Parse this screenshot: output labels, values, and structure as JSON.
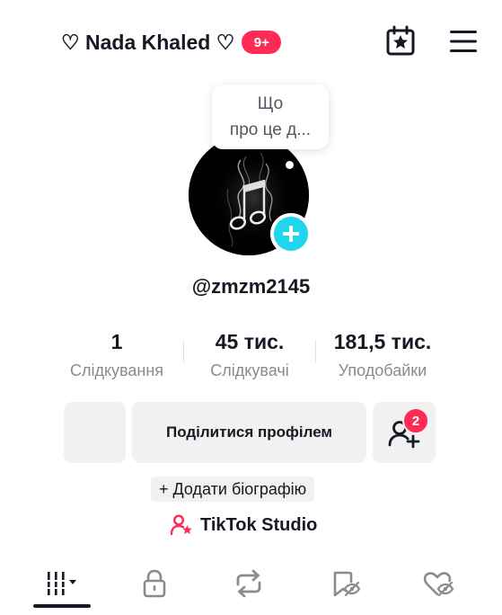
{
  "header": {
    "title": "♡ Nada Khaled ♡",
    "notification_badge": "9+",
    "calendar_icon": "calendar-star-icon",
    "menu_icon": "hamburger-menu-icon"
  },
  "profile": {
    "status_bubble": "Що\nпро це д...",
    "avatar_icon": "music-notes-avatar",
    "username": "@zmzm2145"
  },
  "stats": [
    {
      "value": "1",
      "label": "Слідкування"
    },
    {
      "value": "45 тис.",
      "label": "Слідкувачі"
    },
    {
      "value": "181,5 тис.",
      "label": "Уподобайки"
    }
  ],
  "actions": {
    "share_profile": "Поділитися профілем",
    "add_friends_badge": "2"
  },
  "bio_button": "+ Додати біографію",
  "studio_link": "TikTok Studio",
  "tabs": [
    {
      "icon": "videos-grid-icon"
    },
    {
      "icon": "lock-icon"
    },
    {
      "icon": "repost-icon"
    },
    {
      "icon": "favorites-hidden-icon"
    },
    {
      "icon": "liked-hidden-icon"
    }
  ],
  "colors": {
    "accent": "#fe2c55",
    "add_button": "#20d5ec",
    "text": "#161823",
    "muted": "#8a8b91",
    "button_bg": "#f1f1f2"
  }
}
